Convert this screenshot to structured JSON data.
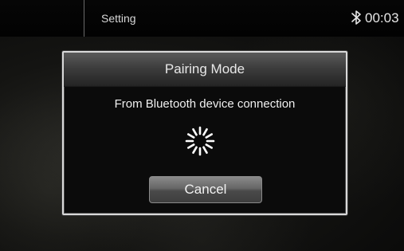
{
  "statusbar": {
    "title": "Setting",
    "bluetooth_icon": "bluetooth-icon",
    "clock": "00:03"
  },
  "dialog": {
    "title": "Pairing Mode",
    "message": "From Bluetooth device connection",
    "spinner_icon": "loading-spinner-icon",
    "cancel_label": "Cancel"
  },
  "colors": {
    "dialog_border": "#d9d9d9",
    "text": "#f0f0f0",
    "button": "#5e5e5e"
  }
}
